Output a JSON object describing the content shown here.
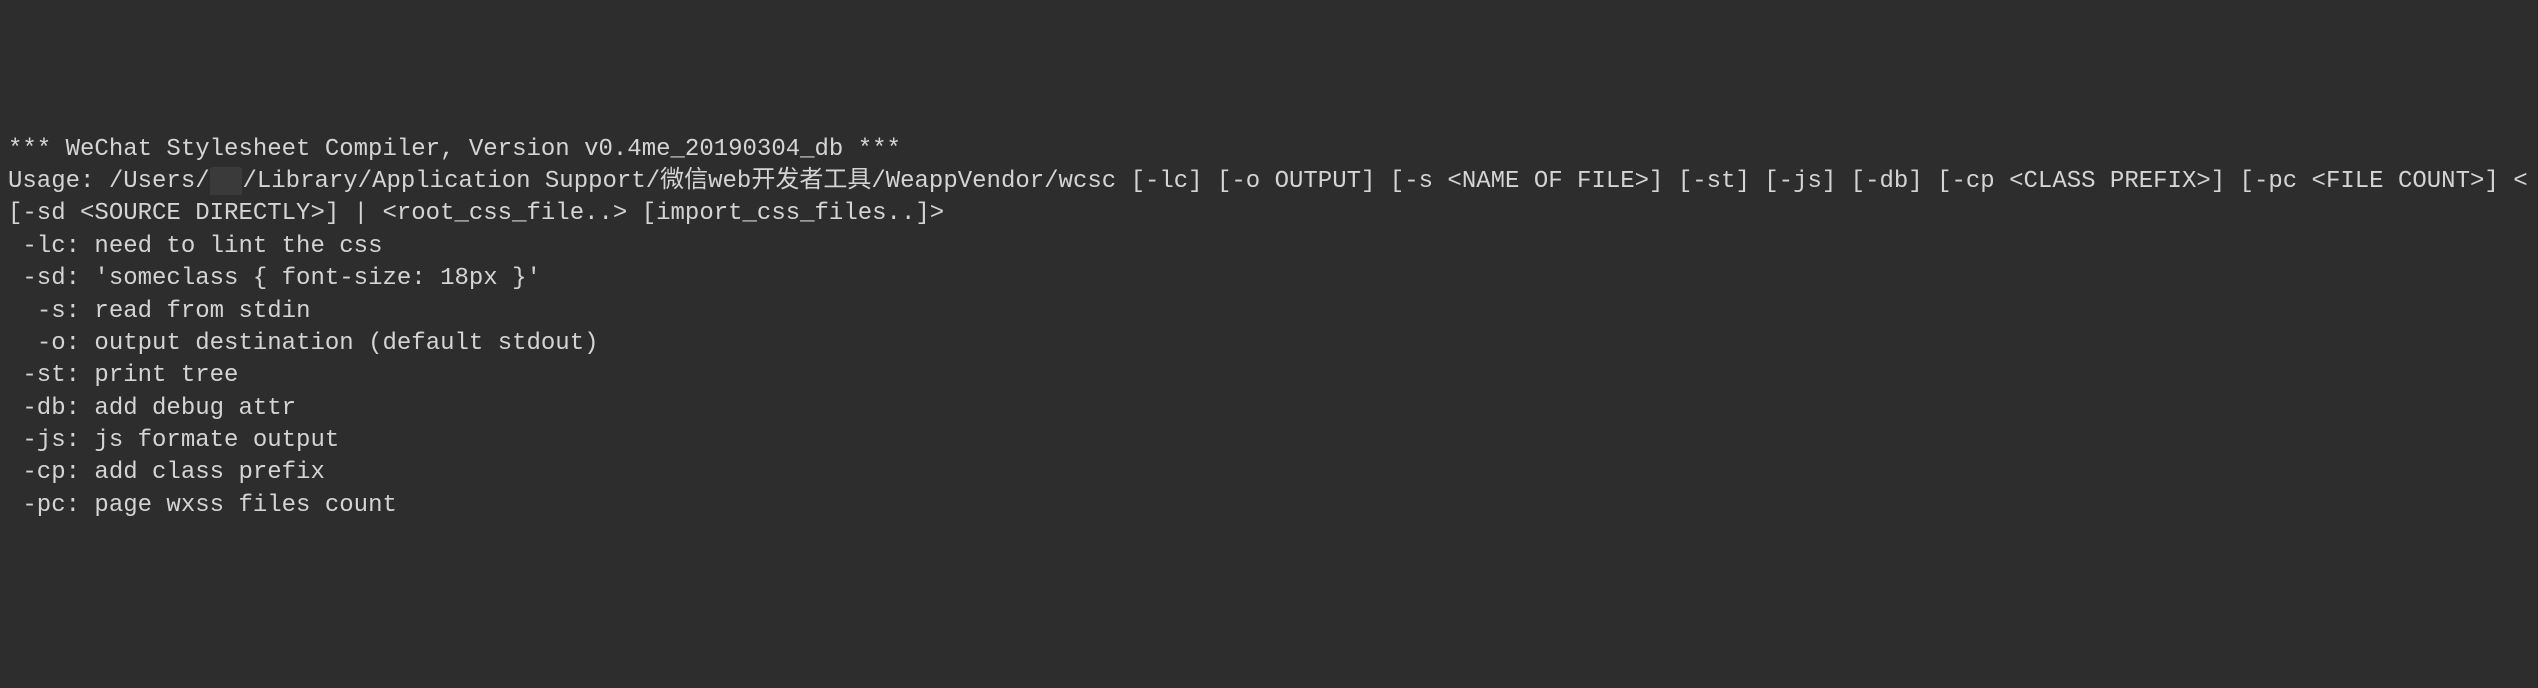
{
  "terminal": {
    "header": "*** WeChat Stylesheet Compiler, Version v0.4me_20190304_db ***",
    "usage_prefix": "Usage: /Users/",
    "usage_redacted": "██",
    "usage_suffix": "/Library/Application Support/微信web开发者工具/WeappVendor/wcsc [-lc] [-o OUTPUT] [-s <NAME OF FILE>] [-st] [-js] [-db] [-cp <CLASS PREFIX>] [-pc <FILE COUNT>] <[-sd <SOURCE DIRECTLY>] | <root_css_file..> [import_css_files..]>",
    "options": [
      {
        "flag": " -lc:",
        "desc": " need to lint the css"
      },
      {
        "flag": " -sd:",
        "desc": " 'someclass { font-size: 18px }'"
      },
      {
        "flag": "  -s:",
        "desc": " read from stdin"
      },
      {
        "flag": "  -o:",
        "desc": " output destination (default stdout)"
      },
      {
        "flag": " -st:",
        "desc": " print tree"
      },
      {
        "flag": " -db:",
        "desc": " add debug attr"
      },
      {
        "flag": " -js:",
        "desc": " js formate output"
      },
      {
        "flag": " -cp:",
        "desc": " add class prefix"
      },
      {
        "flag": " -pc:",
        "desc": " page wxss files count"
      }
    ]
  }
}
